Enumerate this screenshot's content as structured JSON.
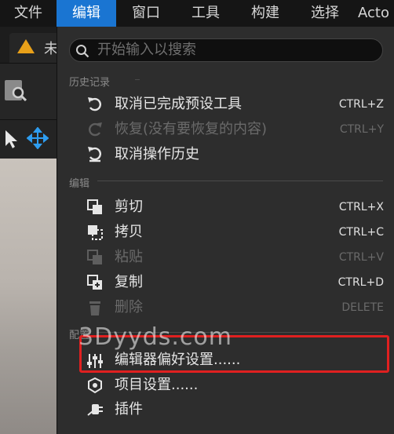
{
  "menubar": {
    "items": [
      {
        "label": "文件"
      },
      {
        "label": "编辑"
      },
      {
        "label": "窗口"
      },
      {
        "label": "工具"
      },
      {
        "label": "构建"
      },
      {
        "label": "选择"
      },
      {
        "label": "Acto"
      }
    ],
    "active_color": "#1a75d2"
  },
  "document_tab": {
    "title": "未"
  },
  "search": {
    "placeholder": "开始输入以搜索"
  },
  "sections": {
    "history": "历史记录",
    "edit": "编辑",
    "config": "配置"
  },
  "history_items": [
    {
      "label": "取消已完成预设工具",
      "shortcut": "CTRL+Z",
      "icon": "undo-icon",
      "enabled": true
    },
    {
      "label": "恢复(没有要恢复的内容)",
      "shortcut": "CTRL+Y",
      "icon": "redo-icon",
      "enabled": false
    },
    {
      "label": "取消操作历史",
      "shortcut": "",
      "icon": "undo-history-icon",
      "enabled": true
    }
  ],
  "edit_items": [
    {
      "label": "剪切",
      "shortcut": "CTRL+X",
      "icon": "cut-icon",
      "enabled": true
    },
    {
      "label": "拷贝",
      "shortcut": "CTRL+C",
      "icon": "copy-icon",
      "enabled": true
    },
    {
      "label": "粘贴",
      "shortcut": "CTRL+V",
      "icon": "paste-icon",
      "enabled": false
    },
    {
      "label": "复制",
      "shortcut": "CTRL+D",
      "icon": "duplicate-icon",
      "enabled": true
    },
    {
      "label": "删除",
      "shortcut": "DELETE",
      "icon": "trash-icon",
      "enabled": false
    }
  ],
  "config_items": [
    {
      "label": "编辑器偏好设置......",
      "icon": "sliders-icon",
      "enabled": true
    },
    {
      "label": "项目设置......",
      "icon": "project-settings-icon",
      "enabled": true
    },
    {
      "label": "插件",
      "icon": "plugin-icon",
      "enabled": true
    }
  ],
  "watermark": "3Dyyds.com",
  "highlight_color": "#e02020"
}
